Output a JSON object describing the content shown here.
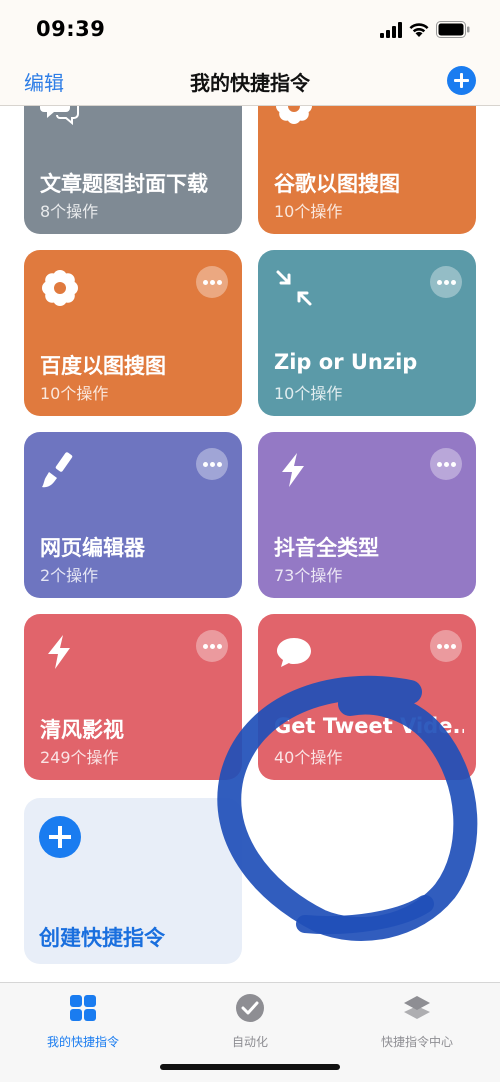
{
  "status_bar": {
    "time": "09:39"
  },
  "nav": {
    "edit_label": "编辑",
    "title": "我的快捷指令"
  },
  "shortcuts": [
    {
      "title": "文章题图封面下载",
      "subtitle": "8个操作",
      "color": "#7f8a94",
      "icon": "speech-bubbles-icon"
    },
    {
      "title": "谷歌以图搜图",
      "subtitle": "10个操作",
      "color": "#e07a3e",
      "icon": "flower-icon"
    },
    {
      "title": "百度以图搜图",
      "subtitle": "10个操作",
      "color": "#e07a3e",
      "icon": "flower-icon"
    },
    {
      "title": "Zip or Unzip",
      "subtitle": "10个操作",
      "color": "#5b9aa8",
      "icon": "compress-arrows-icon"
    },
    {
      "title": "网页编辑器",
      "subtitle": "2个操作",
      "color": "#6e75c0",
      "icon": "paintbrush-icon"
    },
    {
      "title": "抖音全类型",
      "subtitle": "73个操作",
      "color": "#9479c5",
      "icon": "lightning-icon"
    },
    {
      "title": "清风影视",
      "subtitle": "249个操作",
      "color": "#e1646b",
      "icon": "lightning-icon"
    },
    {
      "title": "Get Tweet Vide...",
      "subtitle": "40个操作",
      "color": "#e1646b",
      "icon": "speech-bubble-icon"
    }
  ],
  "create": {
    "label": "创建快捷指令"
  },
  "tabs": [
    {
      "label": "我的快捷指令",
      "icon": "grid-icon",
      "active": true
    },
    {
      "label": "自动化",
      "icon": "clock-check-icon",
      "active": false
    },
    {
      "label": "快捷指令中心",
      "icon": "layers-icon",
      "active": false
    }
  ],
  "accent_color": "#1a7cf0",
  "annotation_color": "#1f4fb8"
}
